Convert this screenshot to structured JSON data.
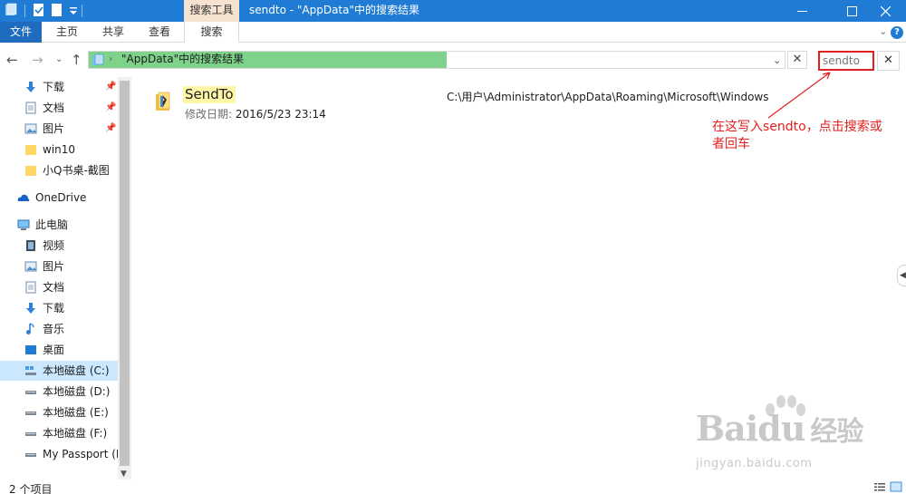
{
  "titlebar": {
    "context_tab": "搜索工具",
    "title": "sendto - \"AppData\"中的搜索结果"
  },
  "ribbon": {
    "tabs": [
      "文件",
      "主页",
      "共享",
      "查看",
      "搜索"
    ]
  },
  "address": {
    "path_segment": "\"AppData\"中的搜索结果"
  },
  "search": {
    "value": "sendto"
  },
  "sidebar": {
    "items": [
      {
        "label": "下载",
        "icon": "download-icon",
        "pinned": true
      },
      {
        "label": "文档",
        "icon": "document-icon",
        "pinned": true
      },
      {
        "label": "图片",
        "icon": "picture-icon",
        "pinned": true
      },
      {
        "label": "win10",
        "icon": "folder-icon",
        "pinned": false
      },
      {
        "label": "小Q书桌-截图",
        "icon": "folder-icon",
        "pinned": false
      },
      {
        "label": "OneDrive",
        "icon": "cloud-icon",
        "pinned": false
      },
      {
        "label": "此电脑",
        "icon": "computer-icon",
        "pinned": false
      },
      {
        "label": "视频",
        "icon": "video-icon",
        "pinned": false
      },
      {
        "label": "图片",
        "icon": "picture-icon",
        "pinned": false
      },
      {
        "label": "文档",
        "icon": "document-icon",
        "pinned": false
      },
      {
        "label": "下载",
        "icon": "download-icon",
        "pinned": false
      },
      {
        "label": "音乐",
        "icon": "music-icon",
        "pinned": false
      },
      {
        "label": "桌面",
        "icon": "desktop-icon",
        "pinned": false
      },
      {
        "label": "本地磁盘 (C:)",
        "icon": "drive-icon",
        "pinned": false,
        "selected": true
      },
      {
        "label": "本地磁盘 (D:)",
        "icon": "drive-icon",
        "pinned": false
      },
      {
        "label": "本地磁盘 (E:)",
        "icon": "drive-icon",
        "pinned": false
      },
      {
        "label": "本地磁盘 (F:)",
        "icon": "drive-icon",
        "pinned": false
      },
      {
        "label": "My Passport (H",
        "icon": "drive-icon",
        "pinned": false
      }
    ]
  },
  "result": {
    "name": "SendTo",
    "meta_label": "修改日期:",
    "modified": "2016/5/23 23:14",
    "path": "C:\\用户\\Administrator\\AppData\\Roaming\\Microsoft\\Windows"
  },
  "annotation": {
    "text": "在这写入sendto，点击搜索或者回车"
  },
  "watermark": {
    "logo": "Baidu",
    "logo_cn": "经验",
    "url": "jingyan.baidu.com"
  },
  "status": {
    "item_count": "2 个项目"
  },
  "colors": {
    "titlebar": "#1f7bd3",
    "file_tab": "#1f6bbd",
    "context_tab": "#f6e3cf",
    "progress": "#7ed28a",
    "annotation": "#e02020",
    "selected": "#cce8ff",
    "highlight": "#fff7a8"
  }
}
